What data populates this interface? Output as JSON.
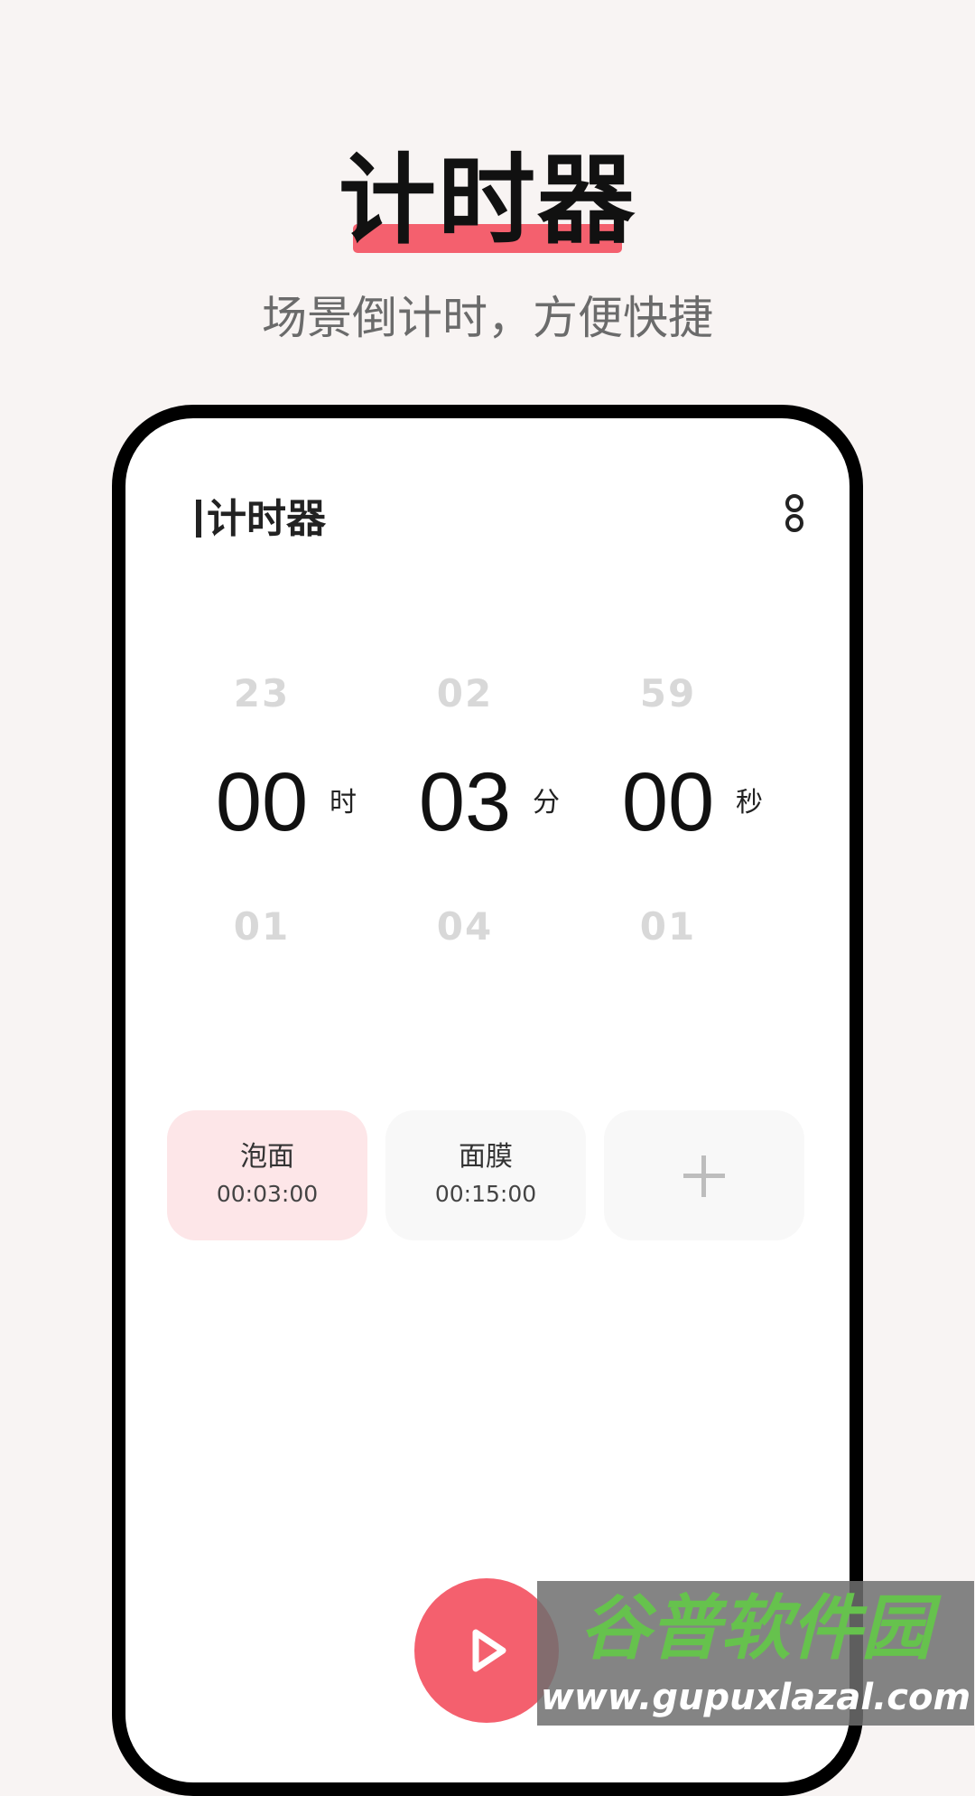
{
  "hero": {
    "title": "计时器",
    "subtitle": "场景倒计时，方便快捷"
  },
  "app": {
    "title": "计时器",
    "menu_icon": "more-vertical-icon"
  },
  "picker": {
    "hours": {
      "prev": "23",
      "current": "00",
      "next": "01",
      "unit": "时"
    },
    "minutes": {
      "prev": "02",
      "current": "03",
      "next": "04",
      "unit": "分"
    },
    "seconds": {
      "prev": "59",
      "current": "00",
      "next": "01",
      "unit": "秒"
    }
  },
  "presets": [
    {
      "name": "泡面",
      "time": "00:03:00",
      "selected": true
    },
    {
      "name": "面膜",
      "time": "00:15:00",
      "selected": false
    }
  ],
  "add_preset": {
    "icon": "plus-icon"
  },
  "play": {
    "icon": "play-icon",
    "color": "#f4606e"
  },
  "watermark": {
    "text": "谷普软件园",
    "url_text": "www.gupuxlazal.com"
  },
  "colors": {
    "accent": "#f4606e",
    "selected_preset_bg": "#fde6e8",
    "background": "#f8f4f3"
  }
}
